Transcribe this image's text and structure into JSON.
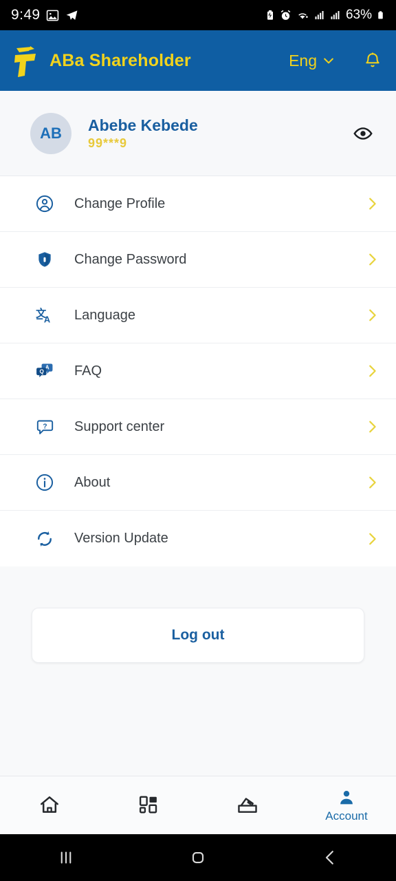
{
  "status_bar": {
    "time": "9:49",
    "left_icons": [
      "photo-icon",
      "telegram-icon"
    ],
    "right_icons": [
      "battery-saver-icon",
      "alarm-icon",
      "wifi-icon",
      "signal-icon-1",
      "signal-icon-2"
    ],
    "battery_percent": "63%"
  },
  "header": {
    "logo": "aba-logo-icon",
    "title": "ABa Shareholder",
    "language": "Eng",
    "language_caret": "chevron-down-icon",
    "notification": "bell-icon",
    "bg_color": "#0f5ea3",
    "accent_color": "#f2d31c"
  },
  "profile": {
    "initials": "AB",
    "name": "Abebe Kebede",
    "account_masked": "99***9",
    "toggle_visibility": "eye-icon"
  },
  "menu": {
    "items": [
      {
        "label": "Change Profile",
        "icon": "user-circle-icon"
      },
      {
        "label": "Change Password",
        "icon": "shield-icon"
      },
      {
        "label": "Language",
        "icon": "translate-icon"
      },
      {
        "label": "FAQ",
        "icon": "qa-bubbles-icon"
      },
      {
        "label": "Support center",
        "icon": "chat-question-icon"
      },
      {
        "label": "About",
        "icon": "info-circle-icon"
      },
      {
        "label": "Version Update",
        "icon": "refresh-icon"
      }
    ],
    "chevron": "chevron-right-icon",
    "chevron_color": "#e8d33c"
  },
  "logout": {
    "label": "Log out"
  },
  "bottom_nav": {
    "items": [
      {
        "label": "",
        "icon": "home-icon",
        "active": false
      },
      {
        "label": "",
        "icon": "grid-icon",
        "active": false
      },
      {
        "label": "",
        "icon": "ballot-icon",
        "active": false
      },
      {
        "label": "Account",
        "icon": "person-icon",
        "active": true
      }
    ],
    "active_color": "#1a6ba8"
  },
  "android_nav": {
    "recents": "recents-icon",
    "home": "home-square-icon",
    "back": "back-chevron-icon"
  }
}
